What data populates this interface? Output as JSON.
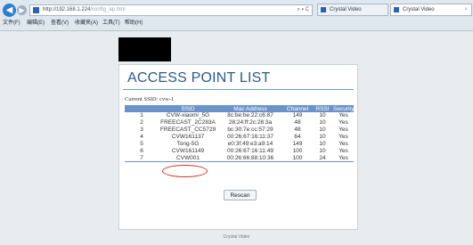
{
  "browser": {
    "url_host": "http://192.168.1.224",
    "url_path": "/config_ap.htm",
    "address_controls": "⌕ ▾ C",
    "tabs": [
      {
        "label": "Crystal Video"
      },
      {
        "label": "Crystal Video",
        "close": "×"
      }
    ],
    "menu": [
      "文件(F)",
      "编辑(E)",
      "查看(V)",
      "收藏夹(A)",
      "工具(T)",
      "帮助(H)"
    ]
  },
  "page": {
    "title": "ACCESS POINT LIST",
    "current_ssid": "Current SSID: cvw-1",
    "columns": [
      "",
      "SSID",
      "Mac Address",
      "Channel",
      "RSSI",
      "Security"
    ],
    "rows": [
      {
        "no": "1",
        "ssid": "CVW-xiaomi_5G",
        "mac": "8c:be:be:22:c6:87",
        "channel": "149",
        "rssi": "10",
        "security": "Yes"
      },
      {
        "no": "2",
        "ssid": "FREECAST_2C283A",
        "mac": "28:24:ff:2c:28:3a",
        "channel": "48",
        "rssi": "10",
        "security": "Yes"
      },
      {
        "no": "3",
        "ssid": "FREECAST_CC5729",
        "mac": "bc:30:7e:cc:57:29",
        "channel": "48",
        "rssi": "10",
        "security": "Yes"
      },
      {
        "no": "4",
        "ssid": "CVW161137",
        "mac": "00:26:67:16:11:37",
        "channel": "64",
        "rssi": "10",
        "security": "Yes"
      },
      {
        "no": "5",
        "ssid": "Tong-5G",
        "mac": "e0:3f:49:e3:a9:14",
        "channel": "149",
        "rssi": "10",
        "security": "Yes"
      },
      {
        "no": "6",
        "ssid": "CVW161149",
        "mac": "00:26:67:16:11:49",
        "channel": "100",
        "rssi": "10",
        "security": "Yes"
      },
      {
        "no": "7",
        "ssid": "CVW001",
        "mac": "00:26:66:88:10:36",
        "channel": "100",
        "rssi": "24",
        "security": "Yes"
      }
    ],
    "rescan_label": "Rescan",
    "footer": "Crystal Video"
  },
  "colors": {
    "table_header": "#6c93c9",
    "title": "#2a5a8c",
    "annotation_circle": "#d5301f"
  }
}
